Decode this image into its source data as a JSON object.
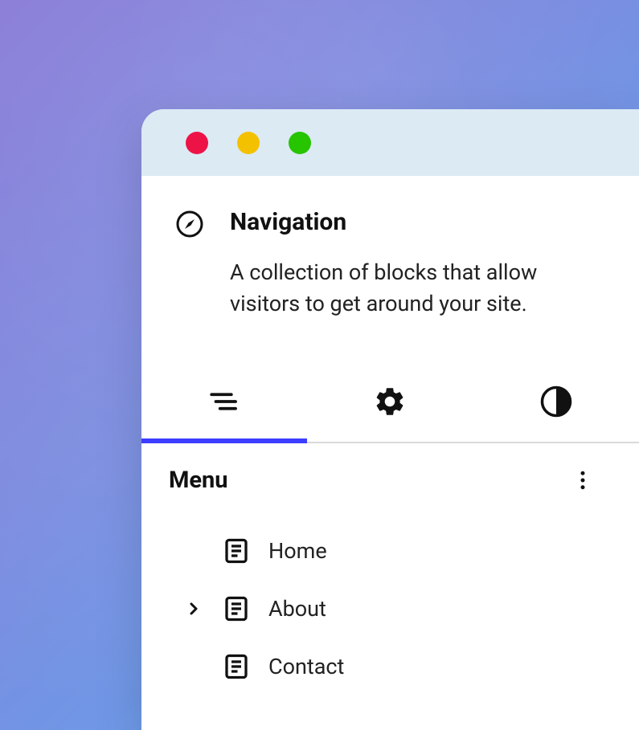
{
  "header": {
    "title": "Navigation",
    "description": "A collection of blocks that allow visitors to get around your site."
  },
  "panel": {
    "title": "Menu"
  },
  "menu": {
    "items": [
      {
        "label": "Home",
        "expandable": false
      },
      {
        "label": "About",
        "expandable": true
      },
      {
        "label": "Contact",
        "expandable": false
      }
    ]
  }
}
